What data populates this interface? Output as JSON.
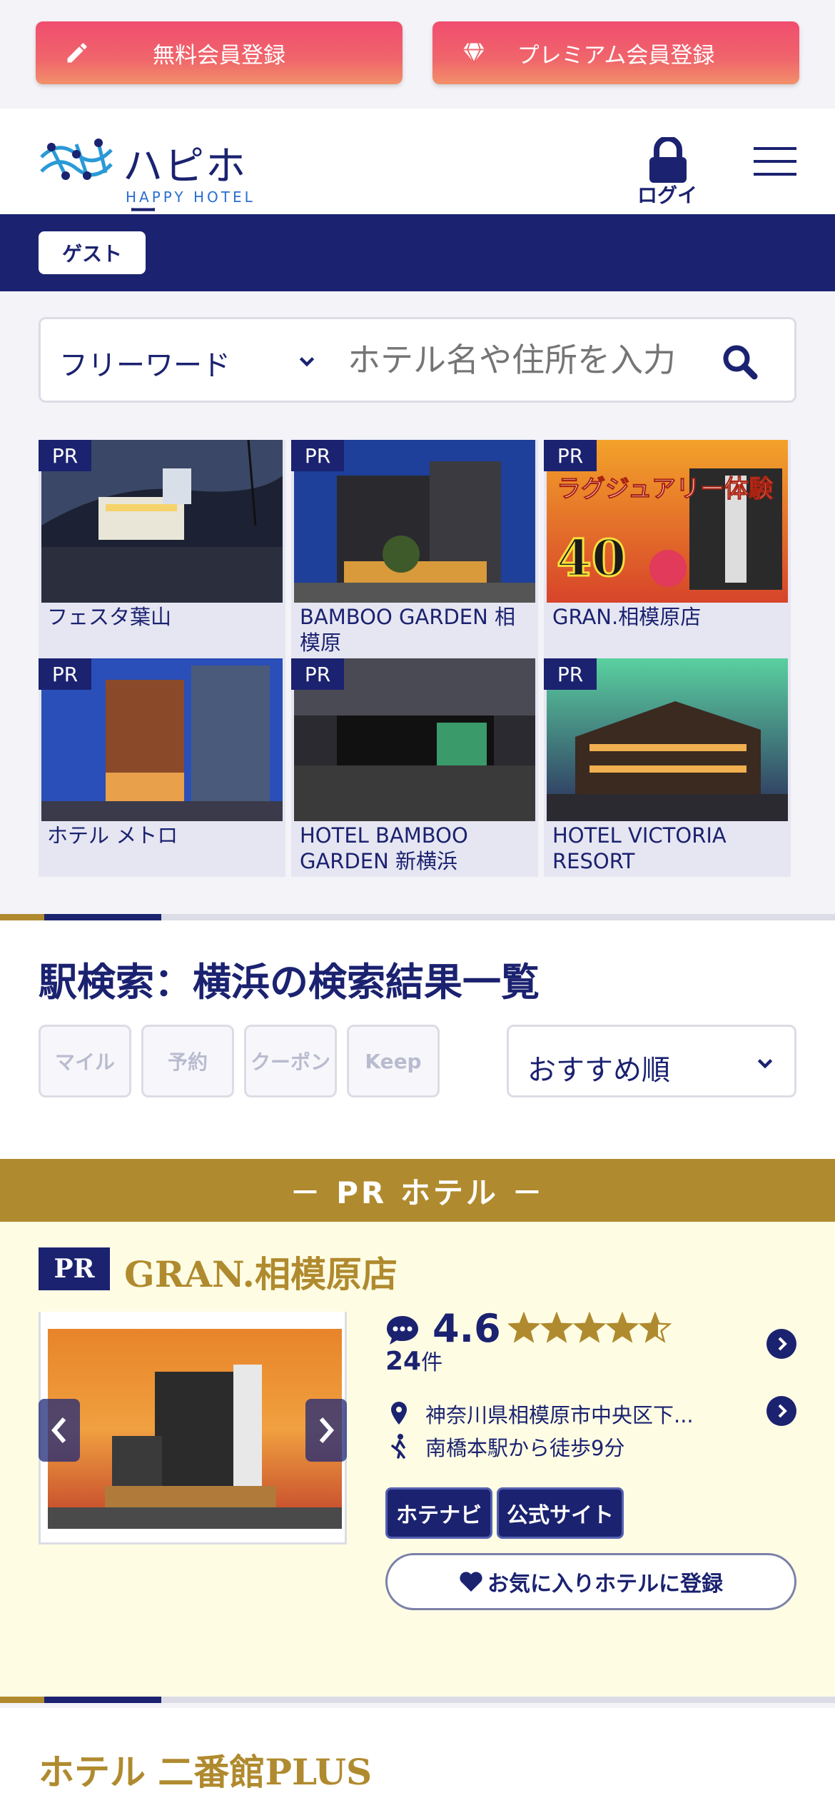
{
  "member": {
    "free_label": "無料会員登録",
    "premium_label": "プレミアム会員登録"
  },
  "header": {
    "logo_text": "ハピホテ",
    "logo_sub": "HAPPY HOTEL",
    "login_label": "ログイン"
  },
  "guest": {
    "label": "ゲスト"
  },
  "search": {
    "select_value": "フリーワード",
    "placeholder": "ホテル名や住所を入力"
  },
  "pr_tag": "PR",
  "pr_cards": [
    {
      "name": "フェスタ葉山"
    },
    {
      "name": "BAMBOO GARDEN 相模原"
    },
    {
      "name": "GRAN.相模原店"
    },
    {
      "name": "ホテル メトロ"
    },
    {
      "name": "HOTEL BAMBOO GARDEN 新横浜"
    },
    {
      "name": "HOTEL VICTORIA RESORT"
    }
  ],
  "results": {
    "title": "駅検索：横浜の検索結果一覧",
    "filters": [
      "マイル",
      "予約",
      "クーポン",
      "Keep"
    ],
    "sort_value": "おすすめ順"
  },
  "pr_hotel_band": "－ PR ホテル －",
  "pr_hotel": {
    "badge": "PR",
    "name": "GRAN.相模原店",
    "score": "4.6",
    "rating": 4.6,
    "review_count": "24",
    "review_unit": "件",
    "address": "神奈川県相模原市中央区下...",
    "access": "南橋本駅から徒歩9分",
    "link_hotenavi": "ホテナビ",
    "link_official": "公式サイト",
    "favorite_label": "お気に入りホテルに登録"
  },
  "next_hotel": {
    "name": "ホテル 二番館PLUS"
  },
  "colors": {
    "navy": "#1b2270",
    "gold": "#b08a2e",
    "pink": "#f04d6f",
    "cream": "#fefde4"
  }
}
